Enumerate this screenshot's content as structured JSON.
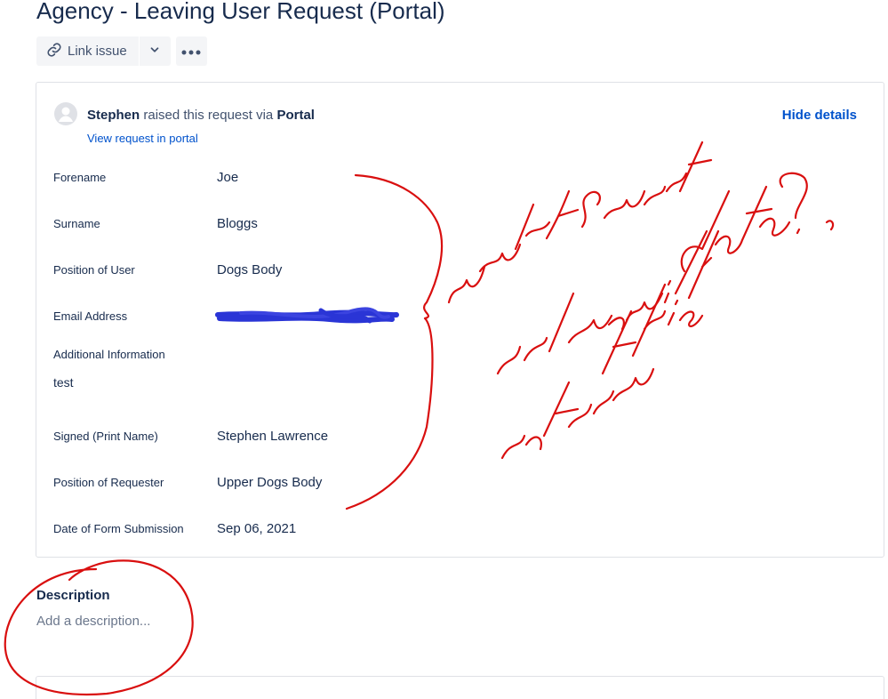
{
  "issue": {
    "title": "Agency - Leaving User Request (Portal)"
  },
  "toolbar": {
    "link_issue_label": "Link issue",
    "chevron_icon": "chevron-down-icon",
    "more_icon": "more-icon",
    "link_icon": "link-icon"
  },
  "request": {
    "reporter": "Stephen",
    "raised_text": "raised this request via",
    "channel": "Portal",
    "view_link": "View request in portal",
    "hide_details": "Hide details",
    "avatar_icon": "user-avatar-icon"
  },
  "fields": [
    {
      "label": "Forename",
      "value": "Joe"
    },
    {
      "label": "Surname",
      "value": "Bloggs"
    },
    {
      "label": "Position of User",
      "value": "Dogs Body"
    },
    {
      "label": "Email Address",
      "value": ""
    },
    {
      "label": "Additional Information",
      "value": "test"
    },
    {
      "label": "Signed (Print Name)",
      "value": "Stephen Lawrence"
    },
    {
      "label": "Position of Requester",
      "value": "Upper Dogs Body"
    },
    {
      "label": "Date of Form Submission",
      "value": "Sep 06, 2021"
    }
  ],
  "description": {
    "label": "Description",
    "placeholder": "Add a description..."
  },
  "colors": {
    "link_blue": "#0052cc",
    "text_dark": "#172b4d",
    "button_bg": "#f4f5f7",
    "redaction_blue": "#2a35d6",
    "annotation_red": "#d90f0f"
  }
}
